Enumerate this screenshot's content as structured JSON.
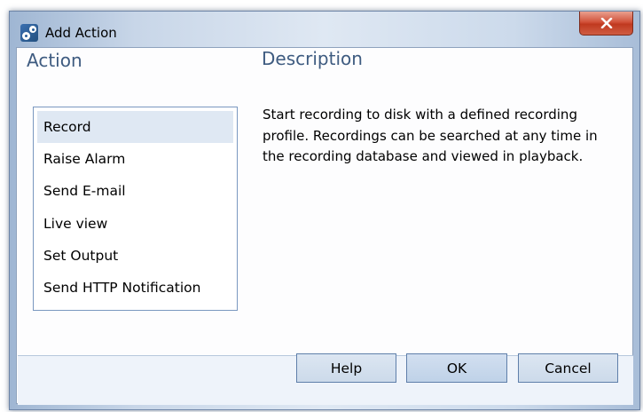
{
  "window": {
    "title": "Add Action",
    "close_icon": "close-icon"
  },
  "action_section": {
    "heading": "Action",
    "items": [
      {
        "label": "Record",
        "selected": true
      },
      {
        "label": "Raise Alarm",
        "selected": false
      },
      {
        "label": "Send E-mail",
        "selected": false
      },
      {
        "label": "Live view",
        "selected": false
      },
      {
        "label": "Set Output",
        "selected": false
      },
      {
        "label": "Send HTTP Notification",
        "selected": false
      }
    ]
  },
  "description_section": {
    "heading": "Description",
    "text": "Start recording to disk with a defined recording profile. Recordings can be searched at any time in the recording database and viewed in playback."
  },
  "buttons": {
    "help": "Help",
    "ok": "OK",
    "cancel": "Cancel"
  },
  "colors": {
    "heading_text": "#3e5b80",
    "selected_item_bg": "#dfe8f3",
    "close_button": "#c8442a"
  }
}
